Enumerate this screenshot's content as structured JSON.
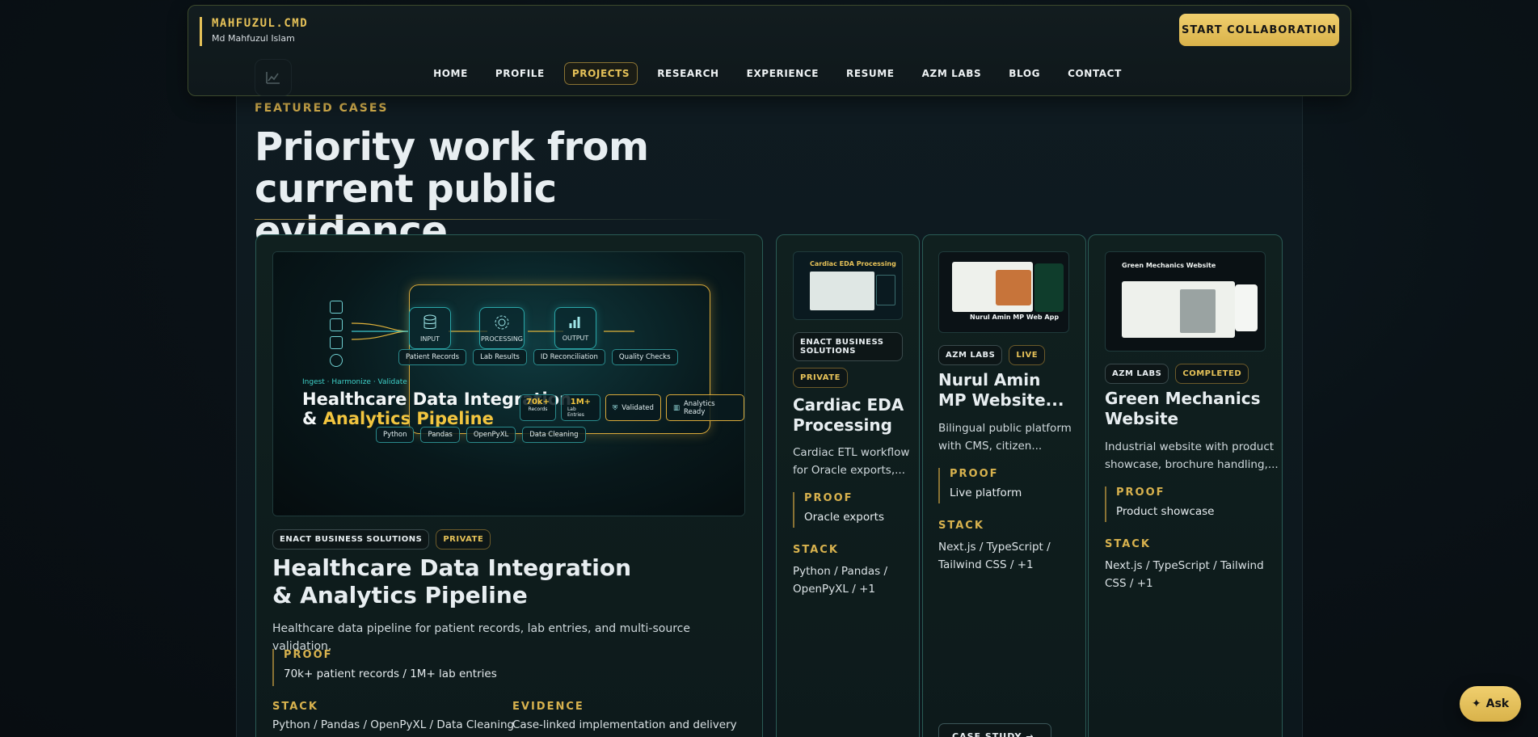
{
  "header": {
    "brand_title": "MAHFUZUL.CMD",
    "brand_subtitle": "Md Mahfuzul Islam",
    "cta_label": "START COLLABORATION",
    "nav": [
      "HOME",
      "PROFILE",
      "PROJECTS",
      "RESEARCH",
      "EXPERIENCE",
      "RESUME",
      "AZM LABS",
      "BLOG",
      "CONTACT"
    ],
    "active_nav": "PROJECTS"
  },
  "hero": {
    "kicker": "FEATURED CASES",
    "title_line1": "Priority work from",
    "title_line2": "current public evidence"
  },
  "featured": {
    "image": {
      "steps": [
        "INPUT",
        "PROCESSING",
        "OUTPUT"
      ],
      "sources": [
        "Patient Records",
        "Lab Results",
        "ID Reconciliation",
        "Quality Checks"
      ],
      "kicker": "Ingest · Harmonize · Validate",
      "title_line1": "Healthcare Data Integration",
      "title_amp": "& ",
      "title_gold": "Analytics Pipeline",
      "stats": [
        {
          "value": "70k+",
          "label": "Records"
        },
        {
          "value": "1M+",
          "label": "Lab Entries"
        },
        {
          "value": "",
          "label": "Validated"
        },
        {
          "value": "",
          "label": "Analytics Ready"
        }
      ],
      "tools": [
        "Python",
        "Pandas",
        "OpenPyXL",
        "Data Cleaning"
      ]
    },
    "tags": [
      "ENACT BUSINESS SOLUTIONS",
      "PRIVATE"
    ],
    "title_line1": "Healthcare Data Integration",
    "title_line2": "& Analytics Pipeline",
    "description": "Healthcare data pipeline for patient records, lab entries, and multi-source validation.",
    "proof_label": "PROOF",
    "proof_value": "70k+ patient records / 1M+ lab entries",
    "stack_label": "STACK",
    "stack_value": "Python / Pandas / OpenPyXL / Data Cleaning",
    "evidence_label": "EVIDENCE",
    "evidence_value": "Case-linked implementation and delivery"
  },
  "cards": [
    {
      "thumb_title": "Cardiac EDA Processing",
      "tags": [
        "ENACT BUSINESS SOLUTIONS",
        "PRIVATE"
      ],
      "title_line1": "Cardiac EDA",
      "title_line2": "Processing",
      "desc_line1": "Cardiac ETL workflow",
      "desc_line2": "for Oracle exports,...",
      "proof_label": "PROOF",
      "proof_value": "Oracle exports",
      "stack_label": "STACK",
      "stack_line1": "Python / Pandas /",
      "stack_line2": "OpenPyXL / +1"
    },
    {
      "thumb_title": "Nurul Amin MP Web App",
      "tags": [
        "AZM LABS",
        "LIVE"
      ],
      "title_line1": "Nurul Amin",
      "title_line2": "MP Website...",
      "desc_line1": "Bilingual public platform",
      "desc_line2": "with CMS, citizen...",
      "proof_label": "PROOF",
      "proof_value": "Live platform",
      "stack_label": "STACK",
      "stack_line1": "Next.js / TypeScript /",
      "stack_line2": "Tailwind CSS / +1",
      "case_button": "CASE STUDY →"
    },
    {
      "thumb_title": "Green Mechanics Website",
      "tags": [
        "AZM LABS",
        "COMPLETED"
      ],
      "title_line1": "Green Mechanics",
      "title_line2": "Website",
      "desc_line1": "Industrial website with product",
      "desc_line2": "showcase, brochure handling,...",
      "proof_label": "PROOF",
      "proof_value": "Product showcase",
      "stack_label": "STACK",
      "stack_line1": "Next.js / TypeScript / Tailwind",
      "stack_line2": "CSS / +1"
    }
  ],
  "ask_label": "Ask",
  "colors": {
    "accent_gold": "#e5c158",
    "teal_border": "#2a5b55",
    "background": "#0a1217"
  },
  "icons": [
    "chart-icon",
    "database-icon",
    "gear-icon",
    "bar-chart-icon",
    "sparkle-icon",
    "arrow-right-icon"
  ]
}
